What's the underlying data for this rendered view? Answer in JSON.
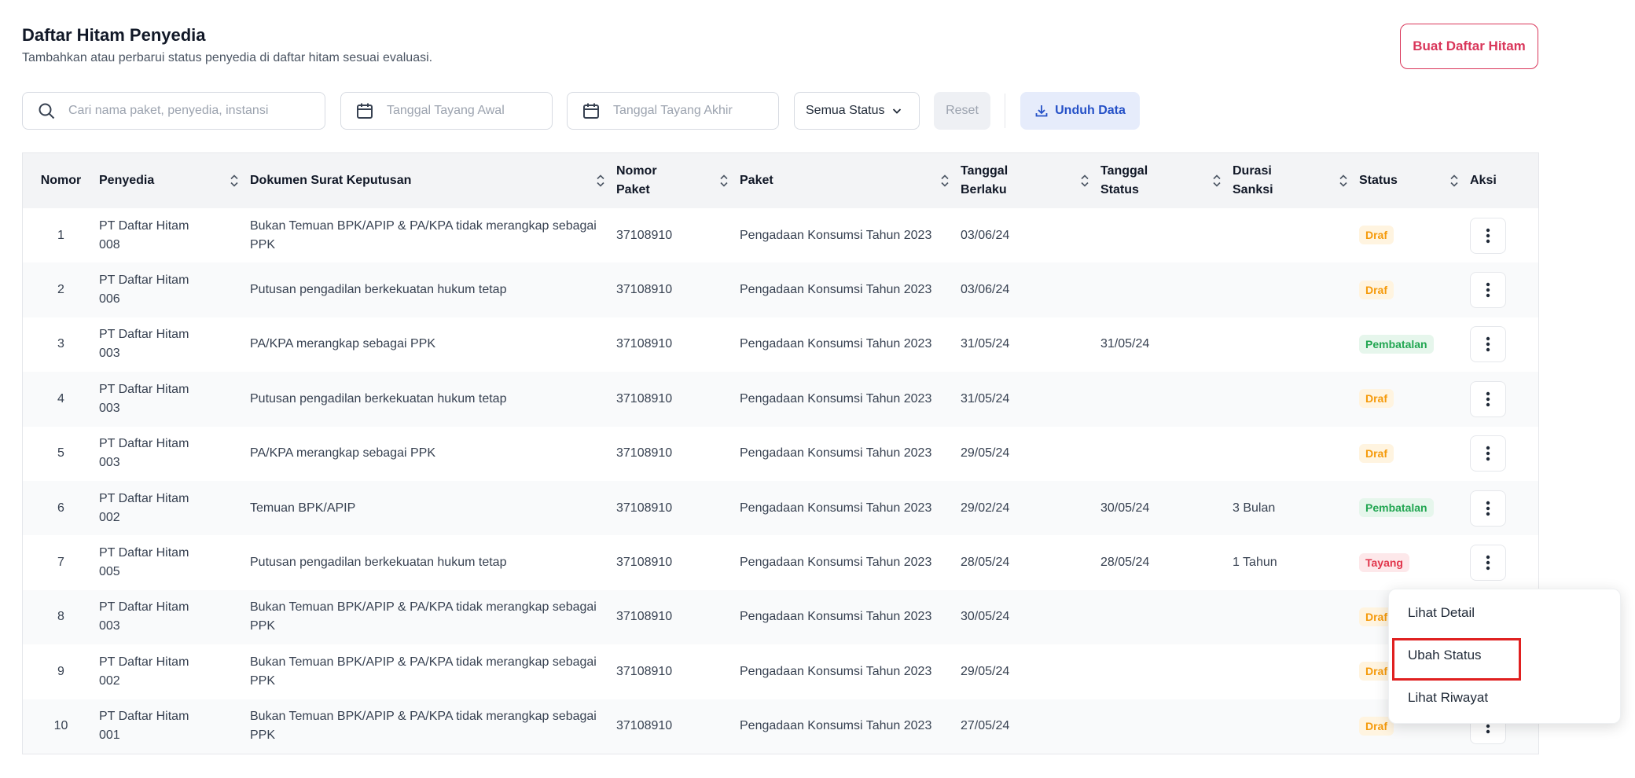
{
  "header": {
    "title": "Daftar Hitam Penyedia",
    "subtitle": "Tambahkan atau perbarui status penyedia di daftar hitam sesuai evaluasi.",
    "create_button": "Buat Daftar Hitam"
  },
  "filters": {
    "search_placeholder": "Cari nama paket, penyedia, instansi",
    "date_start_placeholder": "Tanggal Tayang Awal",
    "date_end_placeholder": "Tanggal Tayang Akhir",
    "status_select": "Semua Status",
    "reset_label": "Reset",
    "download_label": "Unduh Data"
  },
  "table": {
    "columns": {
      "nomor": "Nomor",
      "penyedia": "Penyedia",
      "dokumen": "Dokumen Surat Keputusan",
      "nomor_paket": "Nomor Paket",
      "paket": "Paket",
      "tanggal_berlaku": "Tanggal Berlaku",
      "tanggal_status": "Tanggal Status",
      "durasi_sanksi": "Durasi Sanksi",
      "status": "Status",
      "aksi": "Aksi"
    },
    "rows": [
      {
        "nomor": "1",
        "penyedia": "PT Daftar Hitam 008",
        "dokumen": "Bukan Temuan BPK/APIP & PA/KPA tidak merangkap sebagai PPK",
        "nomor_paket": "37108910",
        "paket": "Pengadaan Konsumsi Tahun 2023",
        "tanggal_berlaku": "03/06/24",
        "tanggal_status": "",
        "durasi": "",
        "status": "Draf"
      },
      {
        "nomor": "2",
        "penyedia": "PT Daftar Hitam 006",
        "dokumen": "Putusan pengadilan berkekuatan hukum tetap",
        "nomor_paket": "37108910",
        "paket": "Pengadaan Konsumsi Tahun 2023",
        "tanggal_berlaku": "03/06/24",
        "tanggal_status": "",
        "durasi": "",
        "status": "Draf"
      },
      {
        "nomor": "3",
        "penyedia": "PT Daftar Hitam 003",
        "dokumen": "PA/KPA merangkap sebagai PPK",
        "nomor_paket": "37108910",
        "paket": "Pengadaan Konsumsi Tahun 2023",
        "tanggal_berlaku": "31/05/24",
        "tanggal_status": "31/05/24",
        "durasi": "",
        "status": "Pembatalan"
      },
      {
        "nomor": "4",
        "penyedia": "PT Daftar Hitam 003",
        "dokumen": "Putusan pengadilan berkekuatan hukum tetap",
        "nomor_paket": "37108910",
        "paket": "Pengadaan Konsumsi Tahun 2023",
        "tanggal_berlaku": "31/05/24",
        "tanggal_status": "",
        "durasi": "",
        "status": "Draf"
      },
      {
        "nomor": "5",
        "penyedia": "PT Daftar Hitam 003",
        "dokumen": "PA/KPA merangkap sebagai PPK",
        "nomor_paket": "37108910",
        "paket": "Pengadaan Konsumsi Tahun 2023",
        "tanggal_berlaku": "29/05/24",
        "tanggal_status": "",
        "durasi": "",
        "status": "Draf"
      },
      {
        "nomor": "6",
        "penyedia": "PT Daftar Hitam 002",
        "dokumen": "Temuan BPK/APIP",
        "nomor_paket": "37108910",
        "paket": "Pengadaan Konsumsi Tahun 2023",
        "tanggal_berlaku": "29/02/24",
        "tanggal_status": "30/05/24",
        "durasi": "3 Bulan",
        "status": "Pembatalan"
      },
      {
        "nomor": "7",
        "penyedia": "PT Daftar Hitam 005",
        "dokumen": "Putusan pengadilan berkekuatan hukum tetap",
        "nomor_paket": "37108910",
        "paket": "Pengadaan Konsumsi Tahun 2023",
        "tanggal_berlaku": "28/05/24",
        "tanggal_status": "28/05/24",
        "durasi": "1 Tahun",
        "status": "Tayang"
      },
      {
        "nomor": "8",
        "penyedia": "PT Daftar Hitam 003",
        "dokumen": "Bukan Temuan BPK/APIP & PA/KPA tidak merangkap sebagai PPK",
        "nomor_paket": "37108910",
        "paket": "Pengadaan Konsumsi Tahun 2023",
        "tanggal_berlaku": "30/05/24",
        "tanggal_status": "",
        "durasi": "",
        "status": "Draf"
      },
      {
        "nomor": "9",
        "penyedia": "PT Daftar Hitam 002",
        "dokumen": "Bukan Temuan BPK/APIP & PA/KPA tidak merangkap sebagai PPK",
        "nomor_paket": "37108910",
        "paket": "Pengadaan Konsumsi Tahun 2023",
        "tanggal_berlaku": "29/05/24",
        "tanggal_status": "",
        "durasi": "",
        "status": "Draf"
      },
      {
        "nomor": "10",
        "penyedia": "PT Daftar Hitam 001",
        "dokumen": "Bukan Temuan BPK/APIP & PA/KPA tidak merangkap sebagai PPK",
        "nomor_paket": "37108910",
        "paket": "Pengadaan Konsumsi Tahun 2023",
        "tanggal_berlaku": "27/05/24",
        "tanggal_status": "",
        "durasi": "",
        "status": "Draf"
      }
    ]
  },
  "row_menu": {
    "items": [
      "Lihat Detail",
      "Ubah Status",
      "Lihat Riwayat"
    ]
  },
  "colors": {
    "accent_red": "#d9365a",
    "accent_blue": "#2450c7",
    "draf": "#f59a0b",
    "pembatalan": "#22a652",
    "tayang": "#e1364c",
    "highlight": "#e02020"
  }
}
